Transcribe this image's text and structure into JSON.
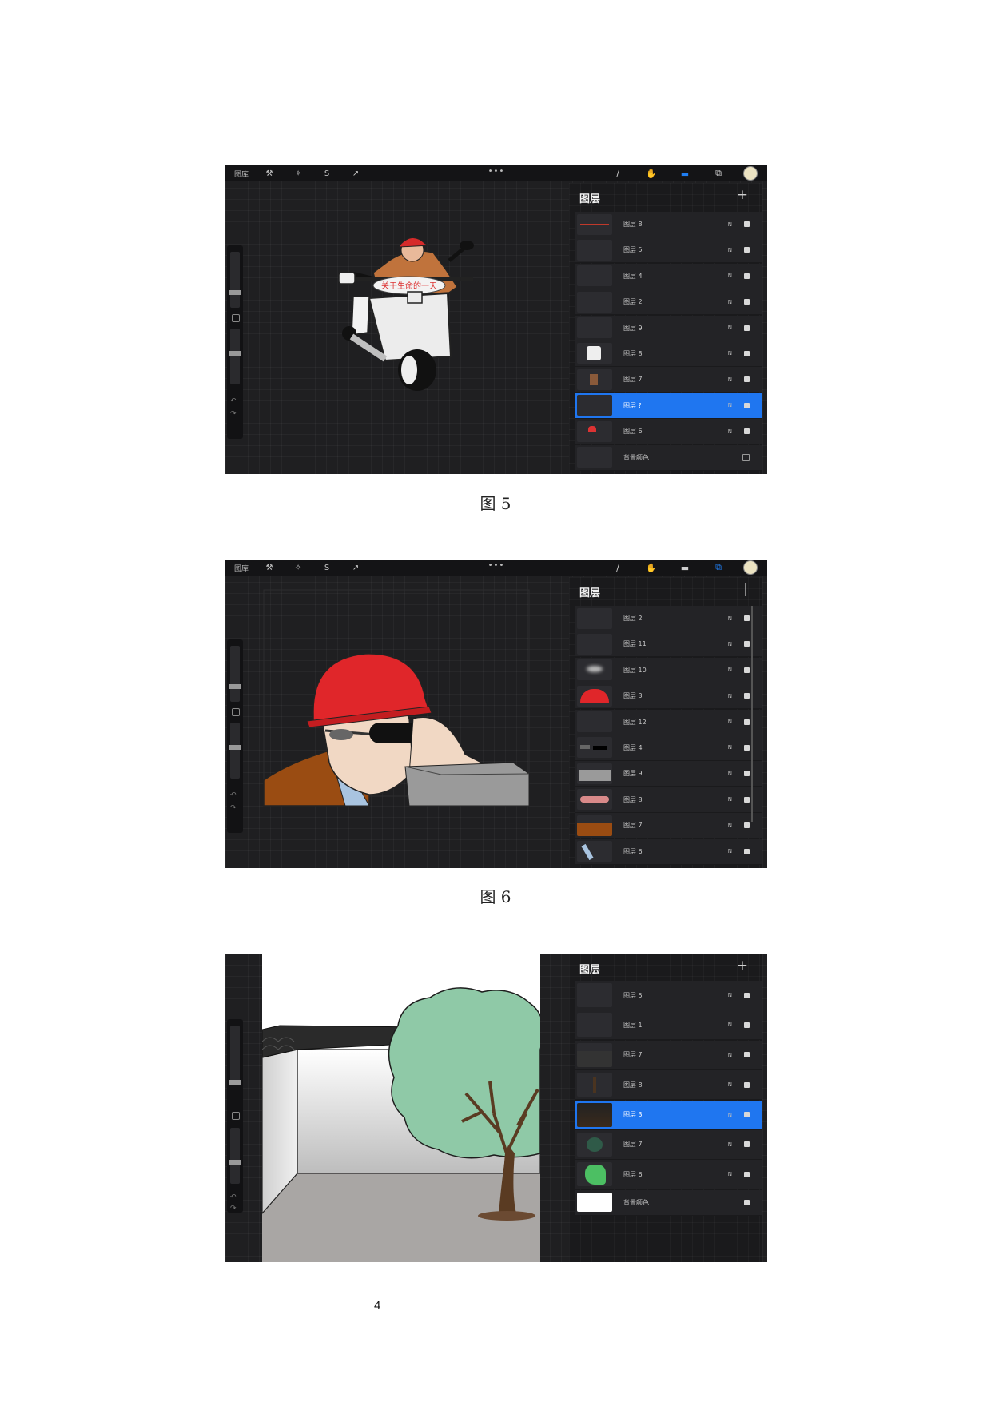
{
  "screenshots": [
    {
      "topbar": {
        "gallery": "图库",
        "dots": "•••"
      },
      "panel": {
        "title": "图层",
        "add": "+"
      },
      "layers": [
        {
          "name": "图层 8",
          "blend": "N",
          "visible": true
        },
        {
          "name": "图层 5",
          "blend": "N",
          "visible": true
        },
        {
          "name": "图层 4",
          "blend": "N",
          "visible": true
        },
        {
          "name": "图层 2",
          "blend": "N",
          "visible": true
        },
        {
          "name": "图层 9",
          "blend": "N",
          "visible": true
        },
        {
          "name": "图层 8",
          "blend": "N",
          "visible": true
        },
        {
          "name": "图层 7",
          "blend": "N",
          "visible": true
        },
        {
          "name": "图层 ?",
          "blend": "N",
          "visible": true,
          "selected": true
        },
        {
          "name": "图层 6",
          "blend": "N",
          "visible": true
        },
        {
          "name": "背景颜色",
          "blend": "",
          "visible": false
        }
      ],
      "banner_text": "关于生命的一天",
      "caption": "图 5"
    },
    {
      "topbar": {
        "gallery": "图库",
        "dots": "•••"
      },
      "panel": {
        "title": "图层",
        "add": "|"
      },
      "layers": [
        {
          "name": "图层 2",
          "blend": "N",
          "visible": true
        },
        {
          "name": "图层 11",
          "blend": "N",
          "visible": true
        },
        {
          "name": "图层 10",
          "blend": "N",
          "visible": true
        },
        {
          "name": "图层 3",
          "blend": "N",
          "visible": true
        },
        {
          "name": "图层 12",
          "blend": "N",
          "visible": true
        },
        {
          "name": "图层 4",
          "blend": "N",
          "visible": true
        },
        {
          "name": "图层 9",
          "blend": "N",
          "visible": true
        },
        {
          "name": "图层 8",
          "blend": "N",
          "visible": true
        },
        {
          "name": "图层 7",
          "blend": "N",
          "visible": true
        },
        {
          "name": "图层 6",
          "blend": "N",
          "visible": true
        }
      ],
      "caption": "图 6"
    },
    {
      "panel": {
        "title": "图层",
        "add": "+"
      },
      "layers": [
        {
          "name": "图层 5",
          "blend": "N",
          "visible": true
        },
        {
          "name": "图层 1",
          "blend": "N",
          "visible": true
        },
        {
          "name": "图层 7",
          "blend": "N",
          "visible": true
        },
        {
          "name": "图层 8",
          "blend": "N",
          "visible": true
        },
        {
          "name": "图层 3",
          "blend": "N",
          "visible": true,
          "selected": true
        },
        {
          "name": "图层 7",
          "blend": "N",
          "visible": true
        },
        {
          "name": "图层 6",
          "blend": "N",
          "visible": true
        },
        {
          "name": "背景颜色",
          "blend": "",
          "visible": true
        }
      ]
    }
  ],
  "page_number": "4",
  "colors": {
    "accent": "#1f76f0",
    "app_bg": "#1f1f21",
    "helmet": "#e0262a"
  }
}
